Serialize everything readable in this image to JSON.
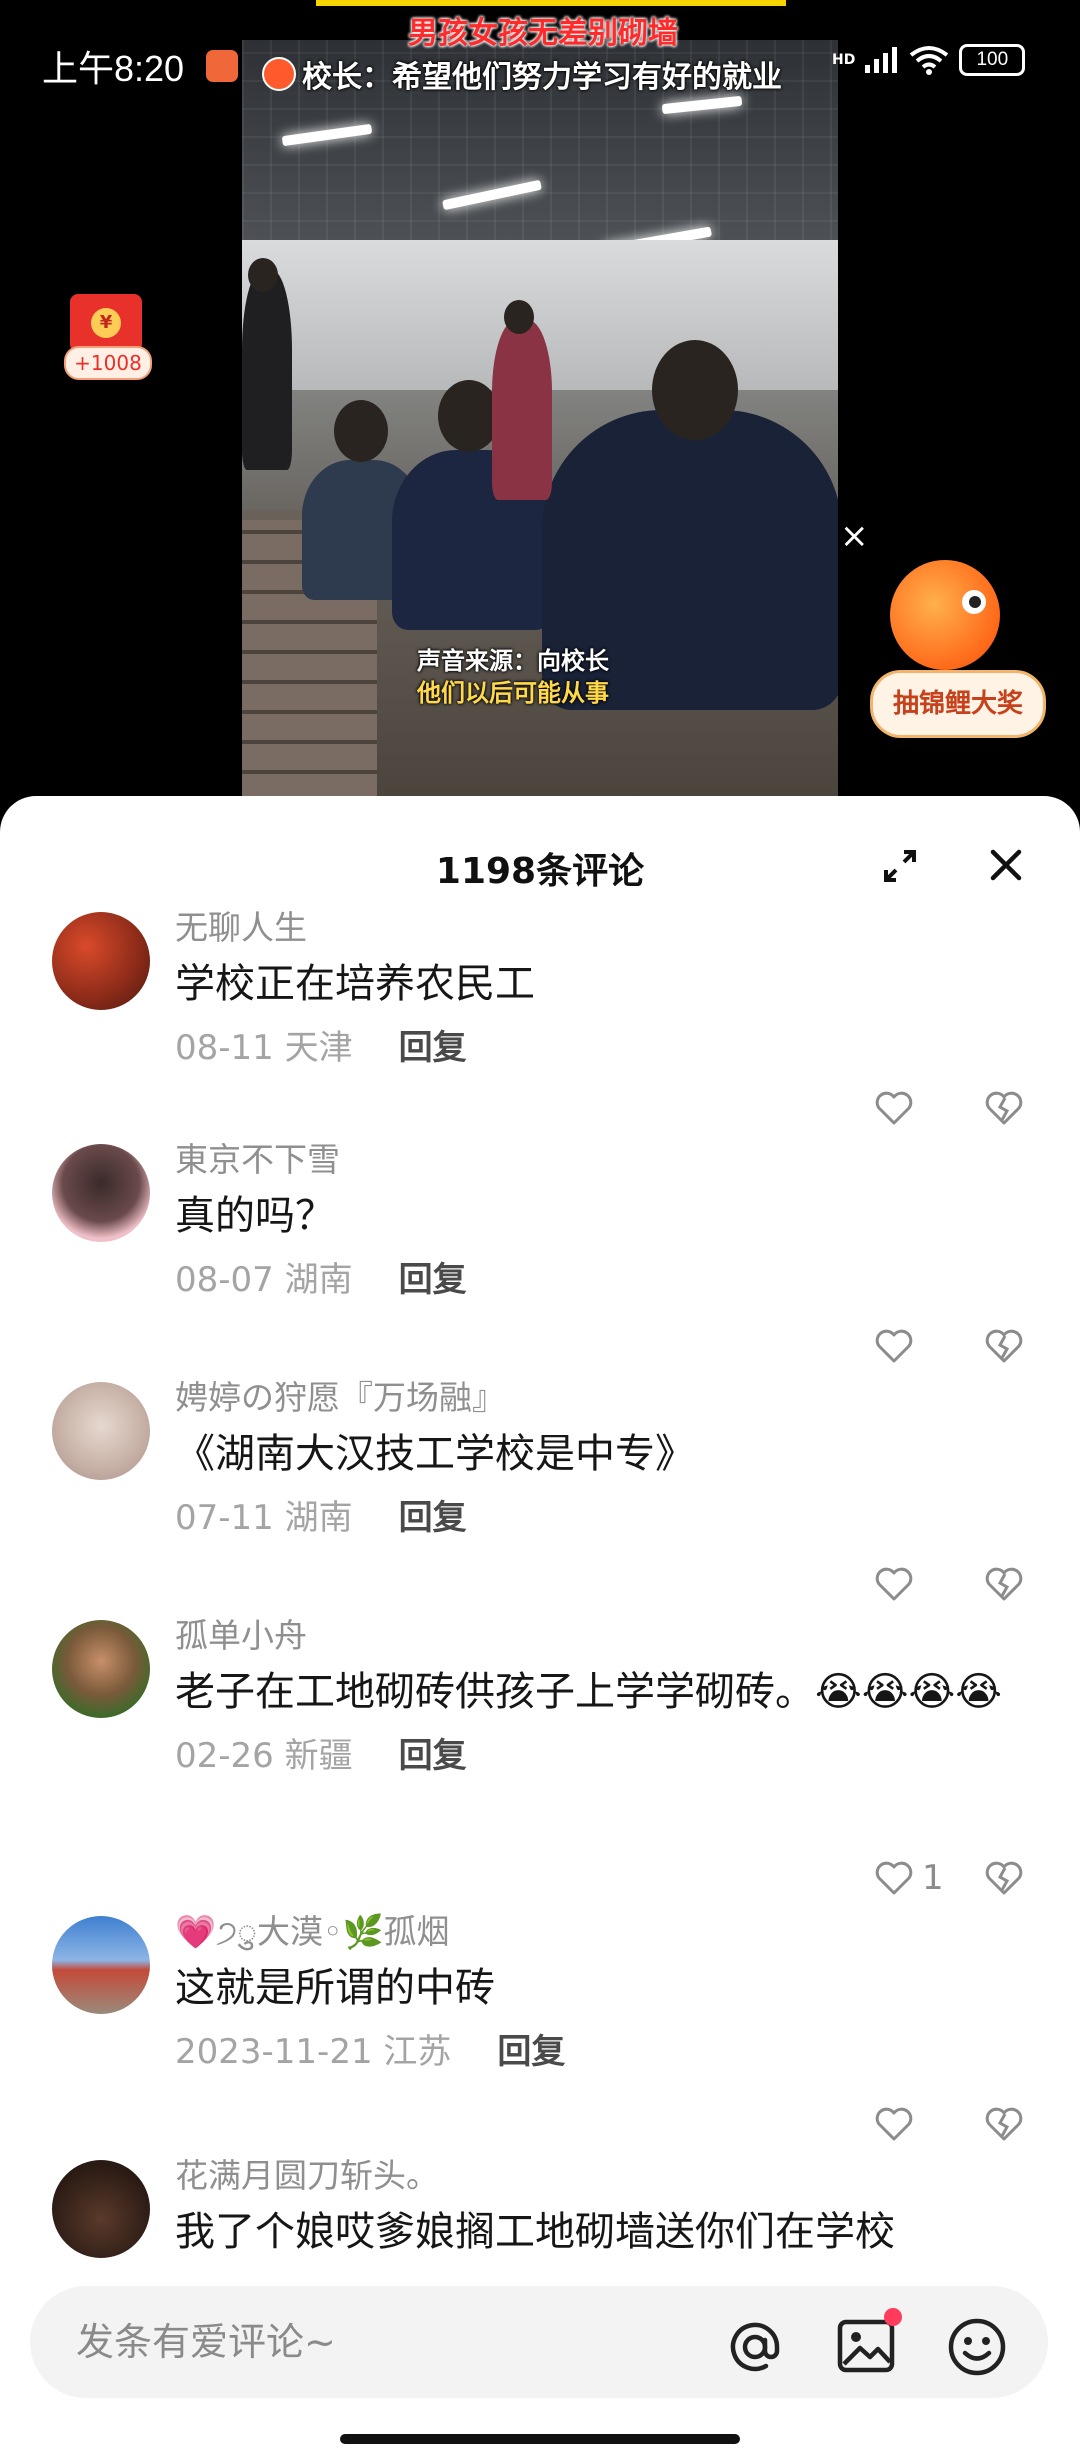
{
  "status_bar": {
    "time": "上午8:20",
    "network": "HD",
    "battery": "100"
  },
  "video": {
    "overlay_title": "男孩女孩无差别砌墙",
    "overlay_subtitle": "校长：希望他们努力学习有好的就业",
    "caption_line1": "声音来源：向校长",
    "caption_line2": "他们以后可能从事",
    "red_packet_amount": "+1008",
    "koi_label": "抽锦鲤大奖"
  },
  "comments_panel": {
    "title": "1198条评论",
    "comments": [
      {
        "username": "无聊人生",
        "content": "学校正在培养农民工",
        "date": "08-11",
        "location": "天津",
        "reply_label": "回复",
        "likes": ""
      },
      {
        "username": "東京不下雪",
        "content": "真的吗？",
        "date": "08-07",
        "location": "湖南",
        "reply_label": "回复",
        "likes": ""
      },
      {
        "username": "娉婷の狩愿『万场融』",
        "content": "《湖南大汉技工学校是中专》",
        "date": "07-11",
        "location": "湖南",
        "reply_label": "回复",
        "likes": ""
      },
      {
        "username": "孤单小舟",
        "content": "老子在工地砌砖供孩子上学学砌砖。😭😭😭😭",
        "date": "02-26",
        "location": "新疆",
        "reply_label": "回复",
        "likes": "1"
      },
      {
        "username": "💗੭ु大漠◦🌿孤烟",
        "content": "这就是所谓的中砖",
        "date": "2023-11-21",
        "location": "江苏",
        "reply_label": "回复",
        "likes": ""
      },
      {
        "username": "花满月圆刀斩头。",
        "content": "我了个娘哎爹娘搁工地砌墙送你们在学校",
        "date": "",
        "location": "",
        "reply_label": "",
        "likes": ""
      }
    ]
  },
  "input_bar": {
    "placeholder": "发条有爱评论~"
  },
  "icons": [
    "expand-icon",
    "close-icon",
    "heart-icon",
    "broken-heart-icon",
    "at-icon",
    "image-icon",
    "emoji-icon"
  ],
  "colors": {
    "accent_red": "#ff3b5c",
    "meta_gray": "#a4a4a4"
  }
}
